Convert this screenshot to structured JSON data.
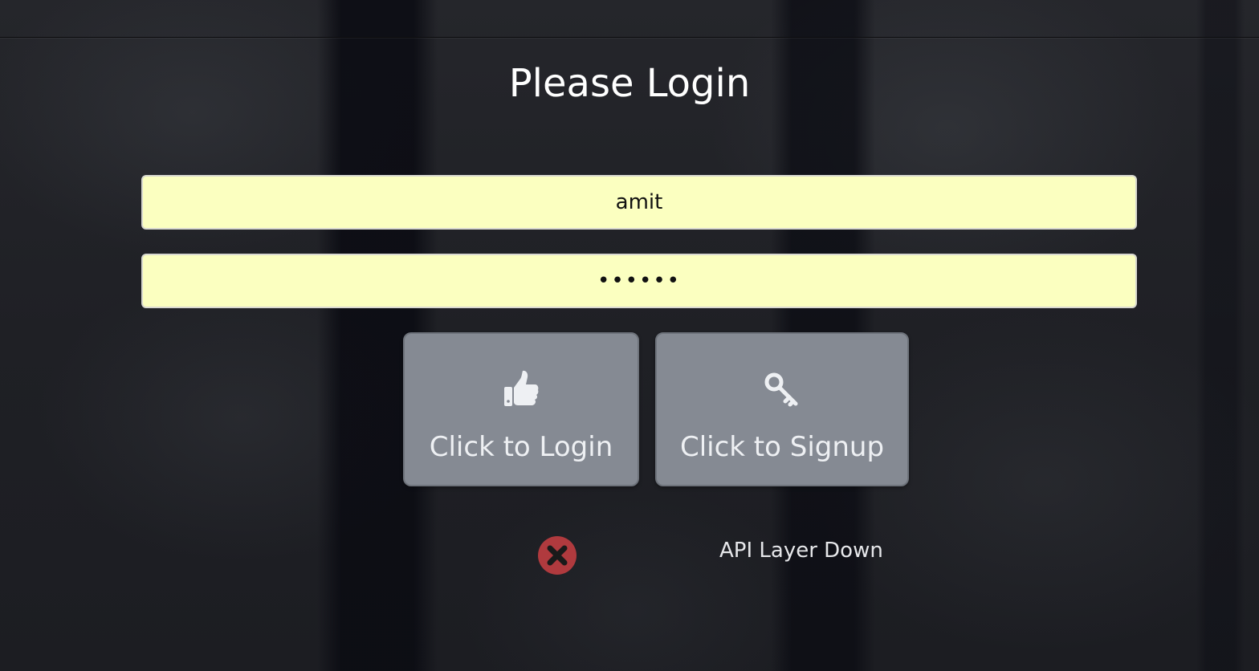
{
  "page": {
    "title": "Please Login"
  },
  "form": {
    "username_value": "amit",
    "password_value": "amit12"
  },
  "buttons": {
    "login_label": "Click to Login",
    "login_icon": "thumbs-up-icon",
    "signup_label": "Click to Signup",
    "signup_icon": "key-icon"
  },
  "status": {
    "icon": "error-x-icon",
    "text": "API Layer Down",
    "color": "#b03a3e"
  },
  "colors": {
    "field_background": "#fbffc0",
    "button_background": "#858a93"
  }
}
